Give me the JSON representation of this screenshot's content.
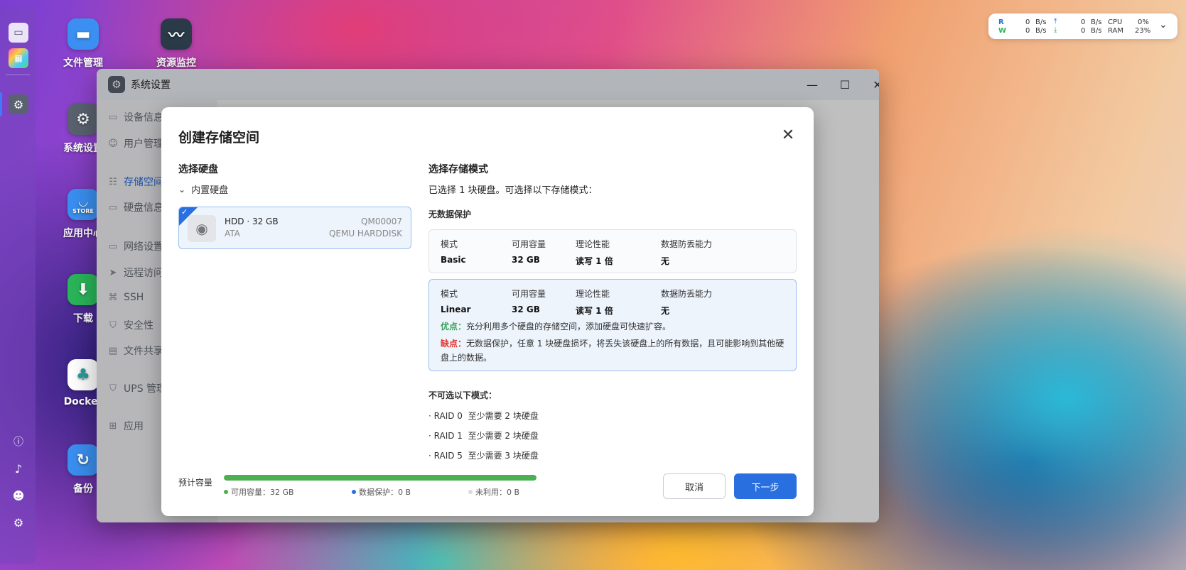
{
  "desktop": {
    "icons": [
      {
        "label": "文件管理",
        "icon": "folder-icon",
        "color": "#3a8ff0"
      },
      {
        "label": "资源监控",
        "icon": "monitor-chart-icon",
        "color": "#2a3a48"
      },
      {
        "label": "系统设置",
        "icon": "gear-icon",
        "color": "#5a6270"
      },
      {
        "label": "应用中心",
        "icon": "store-icon",
        "color": "#3a8ff0"
      },
      {
        "label": "下载",
        "icon": "download-icon",
        "color": "#2ab55a"
      },
      {
        "label": "Docker",
        "icon": "docker-icon",
        "color": "#ffffff"
      },
      {
        "label": "备份",
        "icon": "backup-icon",
        "color": "#3a8ff0"
      }
    ],
    "store_badge": "STORE"
  },
  "network_widget": {
    "r_label": "R",
    "r_value": "0",
    "r_unit": "B/s",
    "w_label": "W",
    "w_value": "0",
    "w_unit": "B/s",
    "up_value": "0",
    "up_unit": "B/s",
    "down_value": "0",
    "down_unit": "B/s",
    "cpu_label": "CPU",
    "cpu_value": "0%",
    "ram_label": "RAM",
    "ram_value": "23%"
  },
  "window": {
    "title": "系统设置",
    "sidebar": [
      {
        "label": "设备信息",
        "icon": "device-icon"
      },
      {
        "label": "用户管理",
        "icon": "user-icon"
      },
      {
        "label": "存储空间",
        "icon": "storage-icon",
        "active": true
      },
      {
        "label": "硬盘信息",
        "icon": "disk-icon"
      },
      {
        "label": "网络设置",
        "icon": "network-icon"
      },
      {
        "label": "远程访问",
        "icon": "remote-icon"
      },
      {
        "label": "SSH",
        "icon": "ssh-icon"
      },
      {
        "label": "安全性",
        "icon": "shield-icon"
      },
      {
        "label": "文件共享",
        "icon": "share-icon"
      },
      {
        "label": "UPS 管理",
        "icon": "ups-icon"
      },
      {
        "label": "应用",
        "icon": "apps-icon"
      }
    ]
  },
  "modal": {
    "title": "创建存储空间",
    "select_disk_heading": "选择硬盘",
    "disk_group": "内置硬盘",
    "disk": {
      "name": "HDD · 32 GB",
      "bus": "ATA",
      "serial": "QM00007",
      "model": "QEMU HARDDISK"
    },
    "select_mode_heading": "选择存储模式",
    "mode_intro": "已选择 1 块硬盘。可选择以下存储模式：",
    "no_protection_heading": "无数据保护",
    "col_headers": {
      "mode": "模式",
      "capacity": "可用容量",
      "performance": "理论性能",
      "protection": "数据防丢能力"
    },
    "modes": [
      {
        "mode": "Basic",
        "capacity": "32 GB",
        "performance": "读写 1 倍",
        "protection": "无"
      },
      {
        "mode": "Linear",
        "capacity": "32 GB",
        "performance": "读写 1 倍",
        "protection": "无",
        "pros_label": "优点：",
        "pros": "充分利用多个硬盘的存储空间，添加硬盘可快速扩容。",
        "cons_label": "缺点：",
        "cons": "无数据保护，任意 1 块硬盘损坏，将丢失该硬盘上的所有数据，且可能影响到其他硬盘上的数据。"
      }
    ],
    "unavailable_heading": "不可选以下模式：",
    "unavailable": [
      {
        "mode": "· RAID 0",
        "req": "至少需要 2 块硬盘"
      },
      {
        "mode": "· RAID 1",
        "req": "至少需要 2 块硬盘"
      },
      {
        "mode": "· RAID 5",
        "req": "至少需要 3 块硬盘"
      }
    ],
    "estimate_label": "预计容量",
    "capacity_fraction": 1.0,
    "legend": {
      "available": "可用容量：32 GB",
      "protection": "数据保护：0 B",
      "unused": "未利用：0 B"
    },
    "colors": {
      "available": "#4caf50",
      "protection": "#2a6fe0",
      "unused": "#d8dbe0",
      "accent": "#2a6fe0"
    },
    "cancel_label": "取消",
    "next_label": "下一步"
  }
}
